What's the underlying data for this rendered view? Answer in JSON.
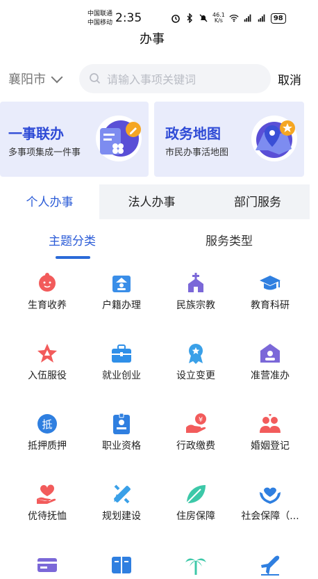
{
  "status_bar": {
    "carrier1": "中国联通",
    "carrier2": "中国移动",
    "time": "2:35",
    "net_speed": "46.1",
    "net_unit": "K/s",
    "battery": "98"
  },
  "header": {
    "title": "办事"
  },
  "search": {
    "city": "襄阳市",
    "placeholder": "请输入事项关键词",
    "cancel": "取消"
  },
  "cards": [
    {
      "title": "一事联办",
      "subtitle": "多事项集成一件事"
    },
    {
      "title": "政务地图",
      "subtitle": "市民办事活地图"
    }
  ],
  "tabs": [
    "个人办事",
    "法人办事",
    "部门服务"
  ],
  "subtabs": [
    "主题分类",
    "服务类型"
  ],
  "grid": [
    {
      "label": "生育收养",
      "icon": "baby-icon",
      "color": "#f25b5b"
    },
    {
      "label": "户籍办理",
      "icon": "household-icon",
      "color": "#3a8ee8"
    },
    {
      "label": "民族宗教",
      "icon": "church-icon",
      "color": "#7b68d8"
    },
    {
      "label": "教育科研",
      "icon": "graduation-cap-icon",
      "color": "#2f7fe0"
    },
    {
      "label": "入伍服役",
      "icon": "army-star-icon",
      "color": "#f25b5b"
    },
    {
      "label": "就业创业",
      "icon": "briefcase-icon",
      "color": "#2f8fe8"
    },
    {
      "label": "设立变更",
      "icon": "badge-icon",
      "color": "#3aa0e8"
    },
    {
      "label": "准营准办",
      "icon": "license-icon",
      "color": "#7b68d8"
    },
    {
      "label": "抵押质押",
      "icon": "mortgage-icon",
      "color": "#2f7fe0"
    },
    {
      "label": "职业资格",
      "icon": "id-card-icon",
      "color": "#2f7fe0"
    },
    {
      "label": "行政缴费",
      "icon": "payment-icon",
      "color": "#f25b5b"
    },
    {
      "label": "婚姻登记",
      "icon": "couple-icon",
      "color": "#f25b5b"
    },
    {
      "label": "优待抚恤",
      "icon": "care-hand-icon",
      "color": "#f25b5b"
    },
    {
      "label": "规划建设",
      "icon": "ruler-pencil-icon",
      "color": "#3aa0e8"
    },
    {
      "label": "住房保障",
      "icon": "leaf-icon",
      "color": "#3cc8a8"
    },
    {
      "label": "社会保障（...",
      "icon": "social-security-icon",
      "color": "#2f7fe0"
    },
    {
      "label": "",
      "icon": "card-icon",
      "color": "#7b68d8"
    },
    {
      "label": "",
      "icon": "book-icon",
      "color": "#2f7fe0"
    },
    {
      "label": "",
      "icon": "palm-tree-icon",
      "color": "#3cc8a8"
    },
    {
      "label": "",
      "icon": "airplane-icon",
      "color": "#2f7fe0"
    }
  ]
}
